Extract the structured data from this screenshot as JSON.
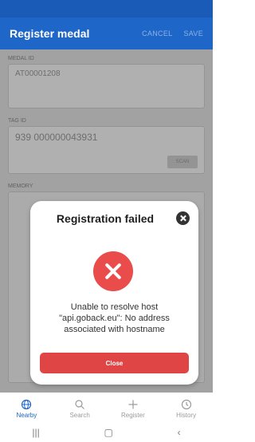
{
  "app": {
    "title": "Register medal",
    "cancel_label": "CANCEL",
    "save_label": "SAVE"
  },
  "form": {
    "medal_id_label": "MEDAL ID",
    "medal_id_value": "AT00001208",
    "tag_id_label": "TAG ID",
    "tag_id_value": "939 000000043931",
    "scan_label": "SCAN",
    "memory_label": "MEMORY"
  },
  "dialog": {
    "title": "Registration failed",
    "message": "Unable to resolve host \"api.goback.eu\": No address associated with hostname",
    "button_label": "Close"
  },
  "nav": {
    "items": [
      {
        "label": "Nearby",
        "icon": "globe-icon",
        "active": true
      },
      {
        "label": "Search",
        "icon": "search-icon",
        "active": false
      },
      {
        "label": "Register",
        "icon": "plus-icon",
        "active": false
      },
      {
        "label": "History",
        "icon": "history-icon",
        "active": false
      }
    ]
  },
  "colors": {
    "app_bar": "#1e66c8",
    "error": "#ea4b4b",
    "close_button": "#e04545",
    "active_nav": "#1e66c8"
  }
}
